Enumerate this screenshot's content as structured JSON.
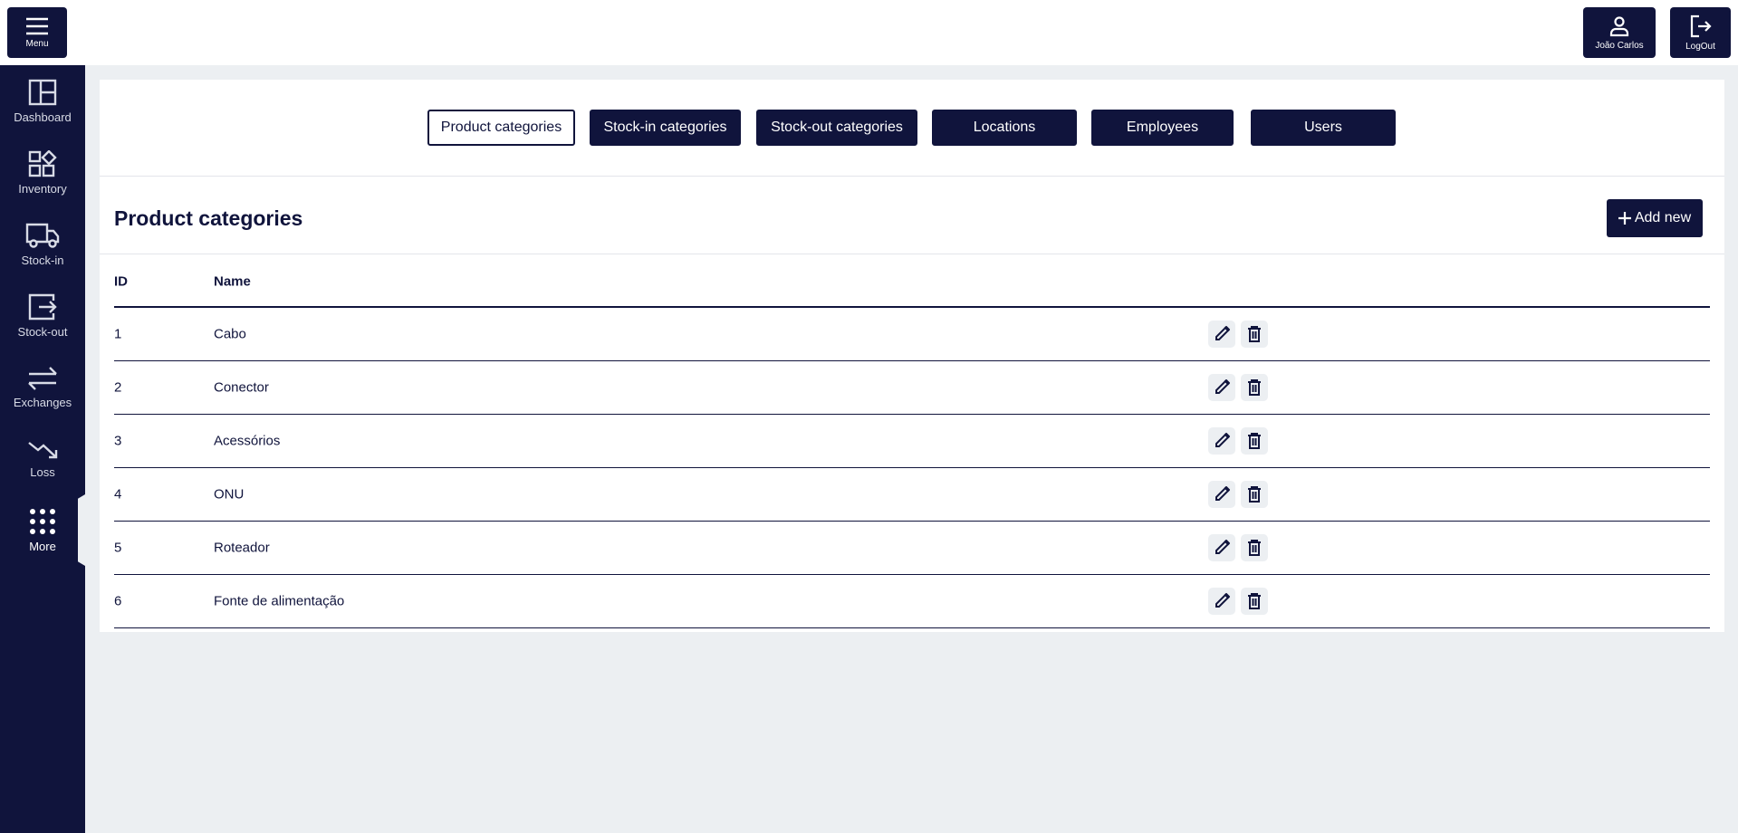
{
  "header": {
    "menu_label": "Menu",
    "user_label": "João Carlos",
    "logout_label": "LogOut"
  },
  "sidebar": {
    "items": [
      {
        "label": "Dashboard"
      },
      {
        "label": "Inventory"
      },
      {
        "label": "Stock-in"
      },
      {
        "label": "Stock-out"
      },
      {
        "label": "Exchanges"
      },
      {
        "label": "Loss"
      },
      {
        "label": "More"
      }
    ]
  },
  "tabs": [
    {
      "label": "Product categories"
    },
    {
      "label": "Stock-in categories"
    },
    {
      "label": "Stock-out categories"
    },
    {
      "label": "Locations"
    },
    {
      "label": "Employees"
    },
    {
      "label": "Users"
    }
  ],
  "main": {
    "title": "Product categories",
    "add_label": "Add new"
  },
  "table": {
    "headers": [
      "ID",
      "Name"
    ],
    "rows": [
      {
        "id": "1",
        "name": "Cabo"
      },
      {
        "id": "2",
        "name": "Conector"
      },
      {
        "id": "3",
        "name": "Acessórios"
      },
      {
        "id": "4",
        "name": "ONU"
      },
      {
        "id": "5",
        "name": "Roteador"
      },
      {
        "id": "6",
        "name": "Fonte de alimentação"
      }
    ]
  }
}
